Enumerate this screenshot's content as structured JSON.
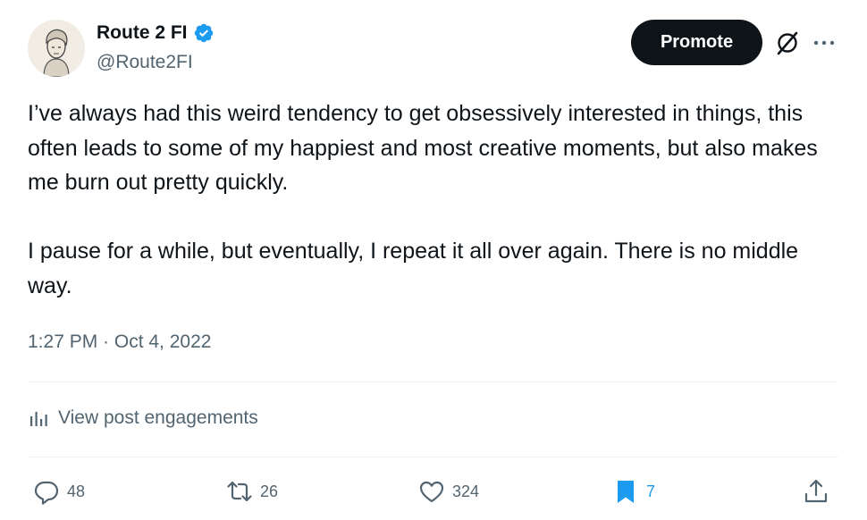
{
  "author": {
    "display_name": "Route 2 FI",
    "handle": "@Route2FI",
    "verified": true
  },
  "header": {
    "promote_label": "Promote"
  },
  "tweet": {
    "text": "I’ve always had this weird tendency to get obsessively interested in things, this often leads to some of my happiest and most creative moments, but also makes me burn out pretty quickly.\n\nI pause for a while, but eventually, I repeat it all over again. There is no middle way.",
    "timestamp": "1:27 PM · Oct 4, 2022"
  },
  "engagements": {
    "label": "View post engagements"
  },
  "actions": {
    "replies": "48",
    "reposts": "26",
    "likes": "324",
    "bookmarks": "7"
  },
  "colors": {
    "text": "#0f1419",
    "secondary": "#536471",
    "accent": "#1d9bf0",
    "button_bg": "#0f1419"
  },
  "icons": [
    "verified-badge-icon",
    "grok-icon",
    "more-icon",
    "analytics-icon",
    "reply-icon",
    "repost-icon",
    "like-icon",
    "bookmark-icon",
    "share-icon"
  ]
}
